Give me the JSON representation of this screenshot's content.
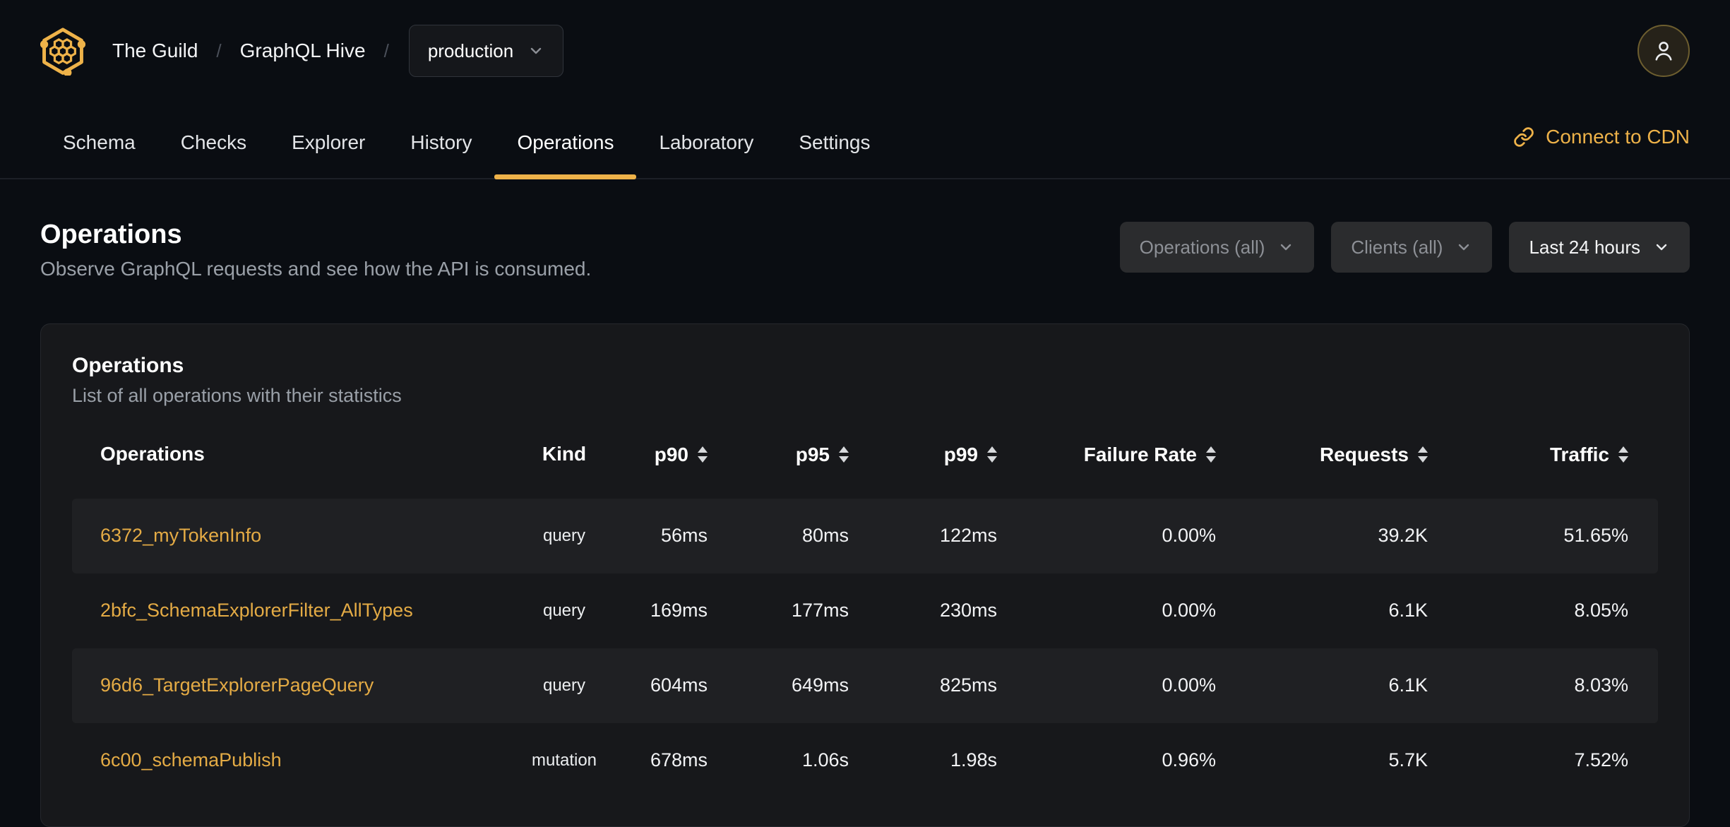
{
  "header": {
    "org": "The Guild",
    "separator": "/",
    "project": "GraphQL Hive",
    "target": "production"
  },
  "nav": {
    "tabs": [
      {
        "label": "Schema",
        "active": false
      },
      {
        "label": "Checks",
        "active": false
      },
      {
        "label": "Explorer",
        "active": false
      },
      {
        "label": "History",
        "active": false
      },
      {
        "label": "Operations",
        "active": true
      },
      {
        "label": "Laboratory",
        "active": false
      },
      {
        "label": "Settings",
        "active": false
      }
    ],
    "cdn_link_label": "Connect to CDN"
  },
  "page": {
    "title": "Operations",
    "subtitle": "Observe GraphQL requests and see how the API is consumed.",
    "filters": [
      {
        "id": "operations",
        "label": "Operations (all)"
      },
      {
        "id": "clients",
        "label": "Clients (all)"
      },
      {
        "id": "period",
        "label": "Last 24 hours"
      }
    ]
  },
  "card": {
    "title": "Operations",
    "subtitle": "List of all operations with their statistics",
    "table": {
      "columns": [
        {
          "label": "Operations",
          "sortable": false
        },
        {
          "label": "Kind",
          "sortable": false
        },
        {
          "label": "p90",
          "sortable": true
        },
        {
          "label": "p95",
          "sortable": true
        },
        {
          "label": "p99",
          "sortable": true
        },
        {
          "label": "Failure Rate",
          "sortable": true
        },
        {
          "label": "Requests",
          "sortable": true
        },
        {
          "label": "Traffic",
          "sortable": true
        }
      ],
      "rows": [
        {
          "name": "6372_myTokenInfo",
          "kind": "query",
          "p90": "56ms",
          "p95": "80ms",
          "p99": "122ms",
          "failure_rate": "0.00%",
          "requests": "39.2K",
          "traffic": "51.65%"
        },
        {
          "name": "2bfc_SchemaExplorerFilter_AllTypes",
          "kind": "query",
          "p90": "169ms",
          "p95": "177ms",
          "p99": "230ms",
          "failure_rate": "0.00%",
          "requests": "6.1K",
          "traffic": "8.05%"
        },
        {
          "name": "96d6_TargetExplorerPageQuery",
          "kind": "query",
          "p90": "604ms",
          "p95": "649ms",
          "p99": "825ms",
          "failure_rate": "0.00%",
          "requests": "6.1K",
          "traffic": "8.03%"
        },
        {
          "name": "6c00_schemaPublish",
          "kind": "mutation",
          "p90": "678ms",
          "p95": "1.06s",
          "p99": "1.98s",
          "failure_rate": "0.96%",
          "requests": "5.7K",
          "traffic": "7.52%"
        }
      ]
    }
  },
  "colors": {
    "accent": "#eeb249",
    "link": "#e4ab45",
    "page_bg": "#0a0d12",
    "card_bg": "#17181b",
    "row_stripe": "#1f2023",
    "muted_text": "#9aa0a8"
  }
}
